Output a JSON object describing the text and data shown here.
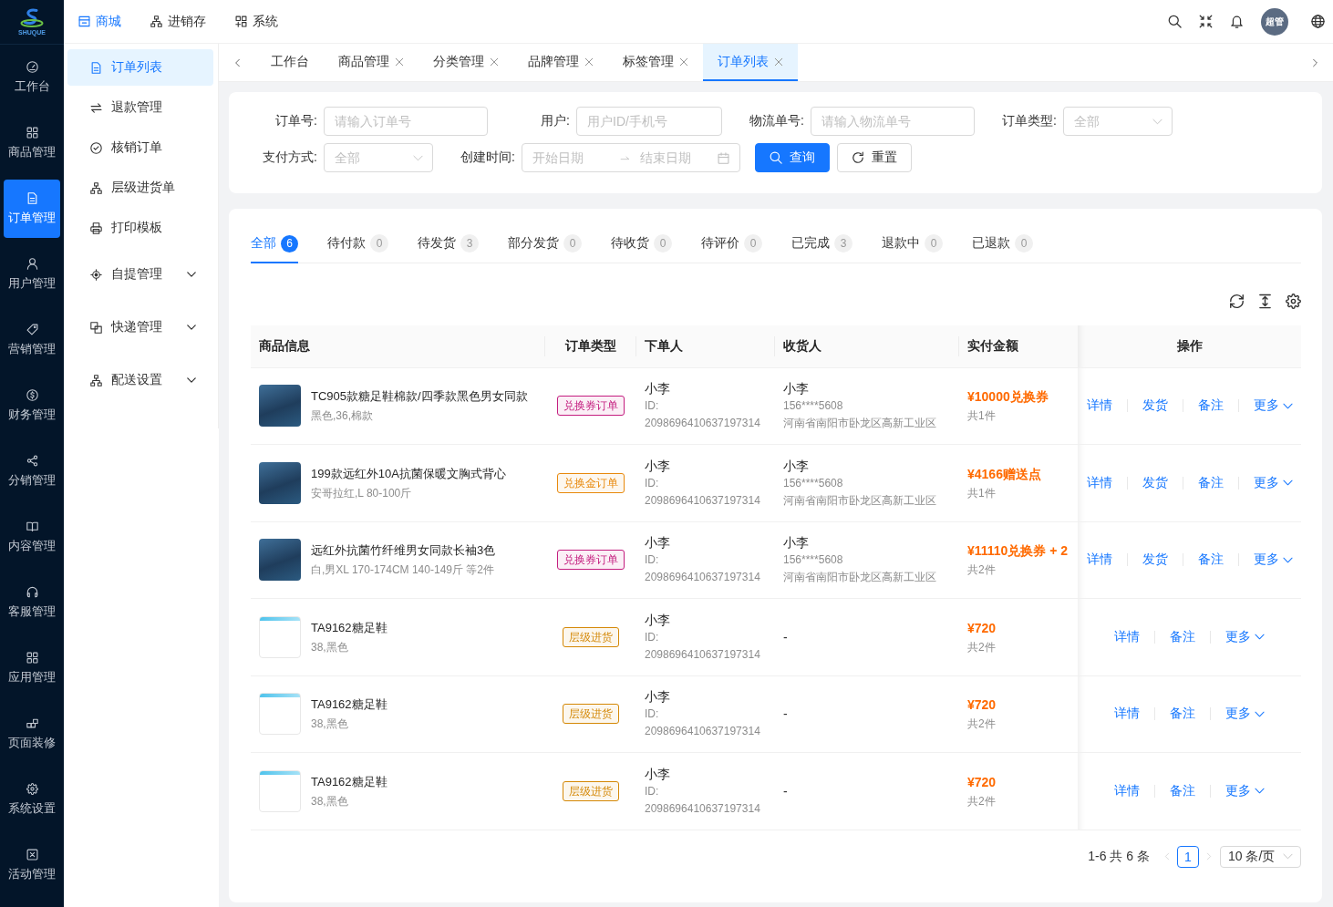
{
  "rail": {
    "logo_text": "SHUQUE",
    "items": [
      {
        "label": "工作台",
        "selected": false
      },
      {
        "label": "商品管理",
        "selected": false
      },
      {
        "label": "订单管理",
        "selected": true
      },
      {
        "label": "用户管理",
        "selected": false
      },
      {
        "label": "营销管理",
        "selected": false
      },
      {
        "label": "财务管理",
        "selected": false
      },
      {
        "label": "分销管理",
        "selected": false
      },
      {
        "label": "内容管理",
        "selected": false
      },
      {
        "label": "客服管理",
        "selected": false
      },
      {
        "label": "应用管理",
        "selected": false
      },
      {
        "label": "页面装修",
        "selected": false
      },
      {
        "label": "系统设置",
        "selected": false
      },
      {
        "label": "活动管理",
        "selected": false
      }
    ]
  },
  "header": {
    "nav": [
      {
        "label": "商城",
        "selected": true
      },
      {
        "label": "进销存",
        "selected": false
      },
      {
        "label": "系统",
        "selected": false
      }
    ],
    "avatar": "超管"
  },
  "submenu": {
    "items": [
      {
        "kind": "link",
        "label": "订单列表",
        "selected": true
      },
      {
        "kind": "link",
        "label": "退款管理",
        "selected": false
      },
      {
        "kind": "link",
        "label": "核销订单",
        "selected": false
      },
      {
        "kind": "link",
        "label": "层级进货单",
        "selected": false
      },
      {
        "kind": "link",
        "label": "打印模板",
        "selected": false
      },
      {
        "kind": "group",
        "label": "自提管理",
        "selected": false,
        "expanded": false
      },
      {
        "kind": "group",
        "label": "快递管理",
        "selected": false,
        "expanded": false
      },
      {
        "kind": "group",
        "label": "配送设置",
        "selected": false,
        "expanded": false
      }
    ]
  },
  "page_tabs": [
    {
      "label": "工作台",
      "selected": false,
      "closable": false
    },
    {
      "label": "商品管理",
      "selected": false,
      "closable": true
    },
    {
      "label": "分类管理",
      "selected": false,
      "closable": true
    },
    {
      "label": "品牌管理",
      "selected": false,
      "closable": true
    },
    {
      "label": "标签管理",
      "selected": false,
      "closable": true
    },
    {
      "label": "订单列表",
      "selected": true,
      "closable": true
    }
  ],
  "filters": {
    "rows": [
      [
        {
          "kind": "input",
          "label": "订单号:",
          "placeholder": "请输入订单号"
        },
        {
          "kind": "input",
          "label": "用户:",
          "placeholder": "用户ID/手机号"
        },
        {
          "kind": "input",
          "label": "物流单号:",
          "placeholder": "请输入物流单号"
        },
        {
          "kind": "select",
          "label": "订单类型:",
          "placeholder": "全部"
        }
      ],
      [
        {
          "kind": "select",
          "label": "支付方式:",
          "placeholder": "全部"
        },
        {
          "kind": "date_range",
          "label": "创建时间:",
          "start_placeholder": "开始日期",
          "end_placeholder": "结束日期"
        }
      ]
    ],
    "buttons": [
      {
        "kind": "primary",
        "label": "查询"
      },
      {
        "kind": "default",
        "label": "重置"
      }
    ]
  },
  "status_tabs": [
    {
      "label": "全部",
      "count": "6",
      "selected": true
    },
    {
      "label": "待付款",
      "count": "0",
      "selected": false
    },
    {
      "label": "待发货",
      "count": "3",
      "selected": false
    },
    {
      "label": "部分发货",
      "count": "0",
      "selected": false
    },
    {
      "label": "待收货",
      "count": "0",
      "selected": false
    },
    {
      "label": "待评价",
      "count": "0",
      "selected": false
    },
    {
      "label": "已完成",
      "count": "3",
      "selected": false
    },
    {
      "label": "退款中",
      "count": "0",
      "selected": false
    },
    {
      "label": "已退款",
      "count": "0",
      "selected": false
    }
  ],
  "table": {
    "columns": [
      "商品信息",
      "订单类型",
      "下单人",
      "收货人",
      "实付金额",
      "操作"
    ],
    "rows": [
      {
        "product": {
          "kind": "photo",
          "name": "TC905款糖足鞋棉款/四季款黑色男女同款",
          "spec": "黑色,36,棉款"
        },
        "order_type": {
          "label": "兑换券订单",
          "color": "#c41d7f"
        },
        "buyer": {
          "name": "小李",
          "id": "ID: 2098696410637197314"
        },
        "receiver": {
          "kind": "address",
          "name": "小李",
          "phone": "156****5608",
          "address": "河南省南阳市卧龙区高新工业区"
        },
        "amount": "¥10000兑换券",
        "quantity": "共1件",
        "actions": [
          {
            "kind": "link",
            "label": "详情"
          },
          {
            "kind": "link",
            "label": "发货"
          },
          {
            "kind": "link",
            "label": "备注"
          },
          {
            "kind": "dropdown",
            "label": "更多"
          }
        ]
      },
      {
        "product": {
          "kind": "photo",
          "name": "199款远红外10A抗菌保暖文胸式背心",
          "spec": "安哥拉红,L 80-100斤"
        },
        "order_type": {
          "label": "兑换金订单",
          "color": "#e8890c"
        },
        "buyer": {
          "name": "小李",
          "id": "ID: 2098696410637197314"
        },
        "receiver": {
          "kind": "address",
          "name": "小李",
          "phone": "156****5608",
          "address": "河南省南阳市卧龙区高新工业区"
        },
        "amount": "¥4166赠送点",
        "quantity": "共1件",
        "actions": [
          {
            "kind": "link",
            "label": "详情"
          },
          {
            "kind": "link",
            "label": "发货"
          },
          {
            "kind": "link",
            "label": "备注"
          },
          {
            "kind": "dropdown",
            "label": "更多"
          }
        ]
      },
      {
        "product": {
          "kind": "photo",
          "name": "远红外抗菌竹纤维男女同款长袖3色",
          "spec": "白,男XL 170-174CM 140-149斤 等2件"
        },
        "order_type": {
          "label": "兑换券订单",
          "color": "#c41d7f"
        },
        "buyer": {
          "name": "小李",
          "id": "ID: 2098696410637197314"
        },
        "receiver": {
          "kind": "address",
          "name": "小李",
          "phone": "156****5608",
          "address": "河南省南阳市卧龙区高新工业区"
        },
        "amount": "¥11110兑换券 + 2",
        "quantity": "共2件",
        "actions": [
          {
            "kind": "link",
            "label": "详情"
          },
          {
            "kind": "link",
            "label": "发货"
          },
          {
            "kind": "link",
            "label": "备注"
          },
          {
            "kind": "dropdown",
            "label": "更多"
          }
        ]
      },
      {
        "product": {
          "kind": "blank",
          "name": "TA9162糖足鞋",
          "spec": "38,黑色"
        },
        "order_type": {
          "label": "层级进货",
          "color": "#d48806"
        },
        "buyer": {
          "name": "小李",
          "id": "ID: 2098696410637197314"
        },
        "receiver": {
          "kind": "none",
          "text": "-"
        },
        "amount": "¥720",
        "quantity": "共2件",
        "actions": [
          {
            "kind": "link",
            "label": "详情"
          },
          {
            "kind": "link",
            "label": "备注"
          },
          {
            "kind": "dropdown",
            "label": "更多"
          }
        ]
      },
      {
        "product": {
          "kind": "blank",
          "name": "TA9162糖足鞋",
          "spec": "38,黑色"
        },
        "order_type": {
          "label": "层级进货",
          "color": "#d48806"
        },
        "buyer": {
          "name": "小李",
          "id": "ID: 2098696410637197314"
        },
        "receiver": {
          "kind": "none",
          "text": "-"
        },
        "amount": "¥720",
        "quantity": "共2件",
        "actions": [
          {
            "kind": "link",
            "label": "详情"
          },
          {
            "kind": "link",
            "label": "备注"
          },
          {
            "kind": "dropdown",
            "label": "更多"
          }
        ]
      },
      {
        "product": {
          "kind": "blank",
          "name": "TA9162糖足鞋",
          "spec": "38,黑色"
        },
        "order_type": {
          "label": "层级进货",
          "color": "#d48806"
        },
        "buyer": {
          "name": "小李",
          "id": "ID: 2098696410637197314"
        },
        "receiver": {
          "kind": "none",
          "text": "-"
        },
        "amount": "¥720",
        "quantity": "共2件",
        "actions": [
          {
            "kind": "link",
            "label": "详情"
          },
          {
            "kind": "link",
            "label": "备注"
          },
          {
            "kind": "dropdown",
            "label": "更多"
          }
        ]
      }
    ]
  },
  "pagination": {
    "summary": "1-6 共 6 条",
    "prev_disabled": true,
    "next_disabled": true,
    "pages": [
      {
        "label": "1",
        "selected": true
      }
    ],
    "page_size": "10 条/页"
  }
}
